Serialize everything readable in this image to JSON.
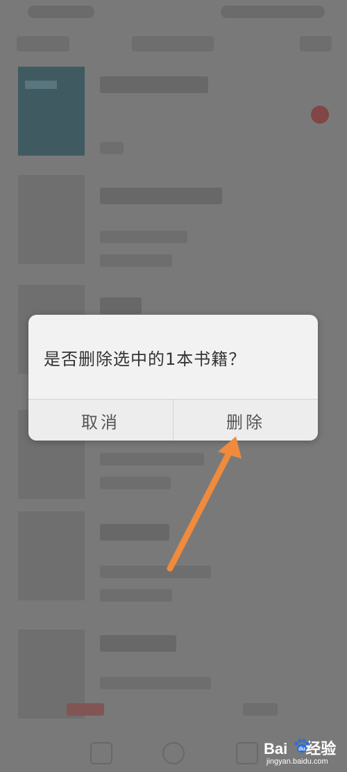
{
  "dialog": {
    "message": "是否删除选中的1本书籍？",
    "cancel_label": "取消",
    "delete_label": "删除"
  },
  "watermark": {
    "brand_prefix": "Bai",
    "brand_suffix": "经验",
    "url": "jingyan.baidu.com"
  },
  "colors": {
    "arrow": "#f08a3c",
    "dialog_bg": "#f2f2f2",
    "dim_bg": "#7f7f7f"
  }
}
